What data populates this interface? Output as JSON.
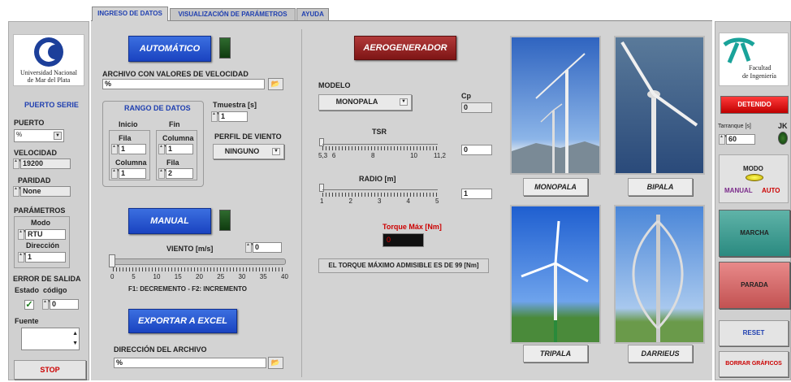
{
  "tabs": [
    "INGRESO DE DATOS",
    "VISUALIZACIÓN DE PARÁMETROS",
    "AYUDA"
  ],
  "left": {
    "logo_line1": "Universidad Nacional",
    "logo_line2": "de Mar del Plata",
    "serial_title": "PUERTO SERIE",
    "port_label": "PUERTO",
    "port_value": "%",
    "velocity_label": "VELOCIDAD",
    "velocity_value": "19200",
    "parity_label": "PARIDAD",
    "parity_value": "None",
    "params_label": "PARÁMETROS",
    "mode_label": "Modo",
    "mode_value": "RTU",
    "direction_label": "Dirección",
    "direction_value": "1",
    "error_title": "ERROR DE SALIDA",
    "status_label": "Estado",
    "code_label": "código",
    "code_value": "0",
    "source_label": "Fuente",
    "stop_label": "STOP"
  },
  "center": {
    "auto_label": "AUTOMÁTICO",
    "file_label": "ARCHIVO CON VALORES DE VELOCIDAD",
    "file_value": "%",
    "range_title": "RANGO DE DATOS",
    "start_label": "Inicio",
    "end_label": "Fin",
    "row_label": "Fila",
    "row_start": "1",
    "row_end_label": "Columna",
    "row_end": "1",
    "col_label": "Columna",
    "col_start": "1",
    "end_row_label": "Fila",
    "end_row": "2",
    "tmuestra_label": "Tmuestra [s]",
    "tmuestra_value": "1",
    "profile_label": "PERFIL DE VIENTO",
    "profile_value": "NINGUNO",
    "manual_label": "MANUAL",
    "wind_label": "VIENTO [m/s]",
    "wind_value": "0",
    "wind_ticks": [
      "0",
      "5",
      "10",
      "15",
      "20",
      "25",
      "30",
      "35",
      "40"
    ],
    "wind_hint": "F1: DECREMENTO - F2: INCREMENTO",
    "export_label": "EXPORTAR A EXCEL",
    "dir_label": "DIRECCIÓN DEL ARCHIVO",
    "dir_value": "%"
  },
  "gen": {
    "aero_label": "AEROGENERADOR",
    "model_label": "MODELO",
    "model_value": "MONOPALA",
    "cp_label": "Cp",
    "cp_value": "0",
    "tsr_label": "TSR",
    "tsr_ticks": [
      "5,3",
      "6",
      "8",
      "10",
      "11,2"
    ],
    "tsr_value": "0",
    "radio_label": "RADIO [m]",
    "radio_ticks": [
      "1",
      "2",
      "3",
      "4",
      "5"
    ],
    "radio_value": "1",
    "torque_label": "Torque Máx [Nm]",
    "torque_value": "0",
    "torque_msg": "EL TORQUE MÁXIMO ADMISIBLE ES DE 99 [Nm]"
  },
  "turbines": {
    "t1": "MONOPALA",
    "t2": "BIPALA",
    "t3": "TRIPALA",
    "t4": "DARRIEUS"
  },
  "right": {
    "logo_line1": "Facultad",
    "logo_line2": "de Ingeniería",
    "status": "DETENIDO",
    "arranque_label": "Tarranque [s]",
    "arranque_value": "60",
    "jk_label": "JK",
    "mode_title": "MODO",
    "manual_label": "MANUAL",
    "auto_label": "AUTO",
    "marcha_label": "MARCHA",
    "parada_label": "PARADA",
    "reset_label": "RESET",
    "clear_label": "BORRAR GRÁFICOS"
  }
}
